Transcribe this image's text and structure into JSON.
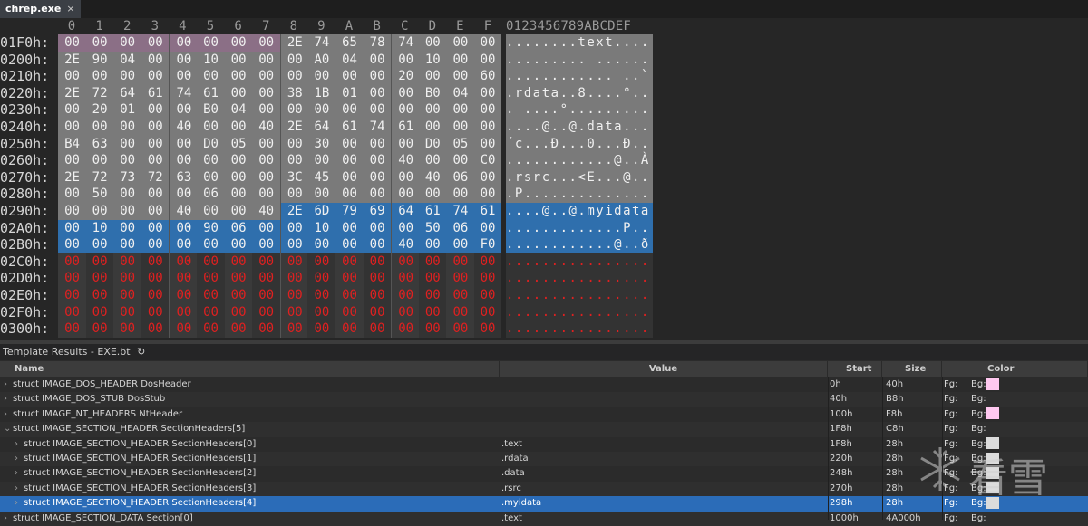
{
  "tab": {
    "title": "chrep.exe",
    "close": "×"
  },
  "hex": {
    "col_headers": [
      "0",
      "1",
      "2",
      "3",
      "4",
      "5",
      "6",
      "7",
      "8",
      "9",
      "A",
      "B",
      "C",
      "D",
      "E",
      "F"
    ],
    "ascii_header": "0123456789ABCDEF",
    "rows": [
      {
        "addr": "01F0h:",
        "bytes": [
          "00",
          "00",
          "00",
          "00",
          "00",
          "00",
          "00",
          "00",
          "2E",
          "74",
          "65",
          "78",
          "74",
          "00",
          "00",
          "00"
        ],
        "ascii": "........text...."
      },
      {
        "addr": "0200h:",
        "bytes": [
          "2E",
          "90",
          "04",
          "00",
          "00",
          "10",
          "00",
          "00",
          "00",
          "A0",
          "04",
          "00",
          "00",
          "10",
          "00",
          "00"
        ],
        "ascii": "......... ......"
      },
      {
        "addr": "0210h:",
        "bytes": [
          "00",
          "00",
          "00",
          "00",
          "00",
          "00",
          "00",
          "00",
          "00",
          "00",
          "00",
          "00",
          "20",
          "00",
          "00",
          "60"
        ],
        "ascii": "............ ..`"
      },
      {
        "addr": "0220h:",
        "bytes": [
          "2E",
          "72",
          "64",
          "61",
          "74",
          "61",
          "00",
          "00",
          "38",
          "1B",
          "01",
          "00",
          "00",
          "B0",
          "04",
          "00"
        ],
        "ascii": ".rdata..8....°.."
      },
      {
        "addr": "0230h:",
        "bytes": [
          "00",
          "20",
          "01",
          "00",
          "00",
          "B0",
          "04",
          "00",
          "00",
          "00",
          "00",
          "00",
          "00",
          "00",
          "00",
          "00"
        ],
        "ascii": ". ....°........."
      },
      {
        "addr": "0240h:",
        "bytes": [
          "00",
          "00",
          "00",
          "00",
          "40",
          "00",
          "00",
          "40",
          "2E",
          "64",
          "61",
          "74",
          "61",
          "00",
          "00",
          "00"
        ],
        "ascii": "....@..@.data..."
      },
      {
        "addr": "0250h:",
        "bytes": [
          "B4",
          "63",
          "00",
          "00",
          "00",
          "D0",
          "05",
          "00",
          "00",
          "30",
          "00",
          "00",
          "00",
          "D0",
          "05",
          "00"
        ],
        "ascii": "´c...Ð...0...Ð.."
      },
      {
        "addr": "0260h:",
        "bytes": [
          "00",
          "00",
          "00",
          "00",
          "00",
          "00",
          "00",
          "00",
          "00",
          "00",
          "00",
          "00",
          "40",
          "00",
          "00",
          "C0"
        ],
        "ascii": "............@..À"
      },
      {
        "addr": "0270h:",
        "bytes": [
          "2E",
          "72",
          "73",
          "72",
          "63",
          "00",
          "00",
          "00",
          "3C",
          "45",
          "00",
          "00",
          "00",
          "40",
          "06",
          "00"
        ],
        "ascii": ".rsrc...<E...@.."
      },
      {
        "addr": "0280h:",
        "bytes": [
          "00",
          "50",
          "00",
          "00",
          "00",
          "06",
          "00",
          "00",
          "00",
          "00",
          "00",
          "00",
          "00",
          "00",
          "00",
          "00"
        ],
        "ascii": ".P.............."
      },
      {
        "addr": "0290h:",
        "bytes": [
          "00",
          "00",
          "00",
          "00",
          "40",
          "00",
          "00",
          "40",
          "2E",
          "6D",
          "79",
          "69",
          "64",
          "61",
          "74",
          "61"
        ],
        "ascii": "....@..@.myidata"
      },
      {
        "addr": "02A0h:",
        "bytes": [
          "00",
          "10",
          "00",
          "00",
          "00",
          "90",
          "06",
          "00",
          "00",
          "10",
          "00",
          "00",
          "00",
          "50",
          "06",
          "00"
        ],
        "ascii": ".............P.."
      },
      {
        "addr": "02B0h:",
        "bytes": [
          "00",
          "00",
          "00",
          "00",
          "00",
          "00",
          "00",
          "00",
          "00",
          "00",
          "00",
          "00",
          "40",
          "00",
          "00",
          "F0"
        ],
        "ascii": "............@..ð"
      },
      {
        "addr": "02C0h:",
        "bytes": [
          "00",
          "00",
          "00",
          "00",
          "00",
          "00",
          "00",
          "00",
          "00",
          "00",
          "00",
          "00",
          "00",
          "00",
          "00",
          "00"
        ],
        "ascii": "................"
      },
      {
        "addr": "02D0h:",
        "bytes": [
          "00",
          "00",
          "00",
          "00",
          "00",
          "00",
          "00",
          "00",
          "00",
          "00",
          "00",
          "00",
          "00",
          "00",
          "00",
          "00"
        ],
        "ascii": "................"
      },
      {
        "addr": "02E0h:",
        "bytes": [
          "00",
          "00",
          "00",
          "00",
          "00",
          "00",
          "00",
          "00",
          "00",
          "00",
          "00",
          "00",
          "00",
          "00",
          "00",
          "00"
        ],
        "ascii": "................"
      },
      {
        "addr": "02F0h:",
        "bytes": [
          "00",
          "00",
          "00",
          "00",
          "00",
          "00",
          "00",
          "00",
          "00",
          "00",
          "00",
          "00",
          "00",
          "00",
          "00",
          "00"
        ],
        "ascii": "................"
      },
      {
        "addr": "0300h:",
        "bytes": [
          "00",
          "00",
          "00",
          "00",
          "00",
          "00",
          "00",
          "00",
          "00",
          "00",
          "00",
          "00",
          "00",
          "00",
          "00",
          "00"
        ],
        "ascii": "................"
      }
    ]
  },
  "template": {
    "title": "Template Results - EXE.bt",
    "refresh_icon": "refresh-icon",
    "columns": {
      "name": "Name",
      "value": "Value",
      "start": "Start",
      "size": "Size",
      "color": "Color"
    },
    "rows": [
      {
        "name": "struct IMAGE_DOS_HEADER DosHeader",
        "value": "",
        "start": "0h",
        "size": "40h",
        "fg": "Fg:",
        "bg": "Bg:",
        "bgcolor": "#ffc8f0",
        "indent": 0,
        "arrow": "›"
      },
      {
        "name": "struct IMAGE_DOS_STUB DosStub",
        "value": "",
        "start": "40h",
        "size": "B8h",
        "fg": "Fg:",
        "bg": "Bg:",
        "bgcolor": "",
        "indent": 0,
        "arrow": "›"
      },
      {
        "name": "struct IMAGE_NT_HEADERS NtHeader",
        "value": "",
        "start": "100h",
        "size": "F8h",
        "fg": "Fg:",
        "bg": "Bg:",
        "bgcolor": "#ffc8f0",
        "indent": 0,
        "arrow": "›"
      },
      {
        "name": "struct IMAGE_SECTION_HEADER SectionHeaders[5]",
        "value": "",
        "start": "1F8h",
        "size": "C8h",
        "fg": "Fg:",
        "bg": "Bg:",
        "bgcolor": "",
        "indent": 0,
        "arrow": "⌄"
      },
      {
        "name": "struct IMAGE_SECTION_HEADER SectionHeaders[0]",
        "value": ".text",
        "start": "1F8h",
        "size": "28h",
        "fg": "Fg:",
        "bg": "Bg:",
        "bgcolor": "#dcdcdc",
        "indent": 1,
        "arrow": "›"
      },
      {
        "name": "struct IMAGE_SECTION_HEADER SectionHeaders[1]",
        "value": ".rdata",
        "start": "220h",
        "size": "28h",
        "fg": "Fg:",
        "bg": "Bg:",
        "bgcolor": "#dcdcdc",
        "indent": 1,
        "arrow": "›"
      },
      {
        "name": "struct IMAGE_SECTION_HEADER SectionHeaders[2]",
        "value": ".data",
        "start": "248h",
        "size": "28h",
        "fg": "Fg:",
        "bg": "Bg:",
        "bgcolor": "#dcdcdc",
        "indent": 1,
        "arrow": "›"
      },
      {
        "name": "struct IMAGE_SECTION_HEADER SectionHeaders[3]",
        "value": ".rsrc",
        "start": "270h",
        "size": "28h",
        "fg": "Fg:",
        "bg": "Bg:",
        "bgcolor": "#dcdcdc",
        "indent": 1,
        "arrow": "›"
      },
      {
        "name": "struct IMAGE_SECTION_HEADER SectionHeaders[4]",
        "value": ".myidata",
        "start": "298h",
        "size": "28h",
        "fg": "Fg:",
        "bg": "Bg:",
        "bgcolor": "#dcdcdc",
        "indent": 1,
        "arrow": "›",
        "selected": true
      },
      {
        "name": "struct IMAGE_SECTION_DATA Section[0]",
        "value": ".text",
        "start": "1000h",
        "size": "4A000h",
        "fg": "Fg:",
        "bg": "Bg:",
        "bgcolor": "",
        "indent": 0,
        "arrow": "›"
      }
    ]
  },
  "watermark": {
    "text": "看雪"
  },
  "colors": {
    "pink": "#8b6f86",
    "gray": "#7a7a7a",
    "blue": "#2f6fad",
    "red": "#e02020",
    "selrow": "#2b6cb8"
  }
}
